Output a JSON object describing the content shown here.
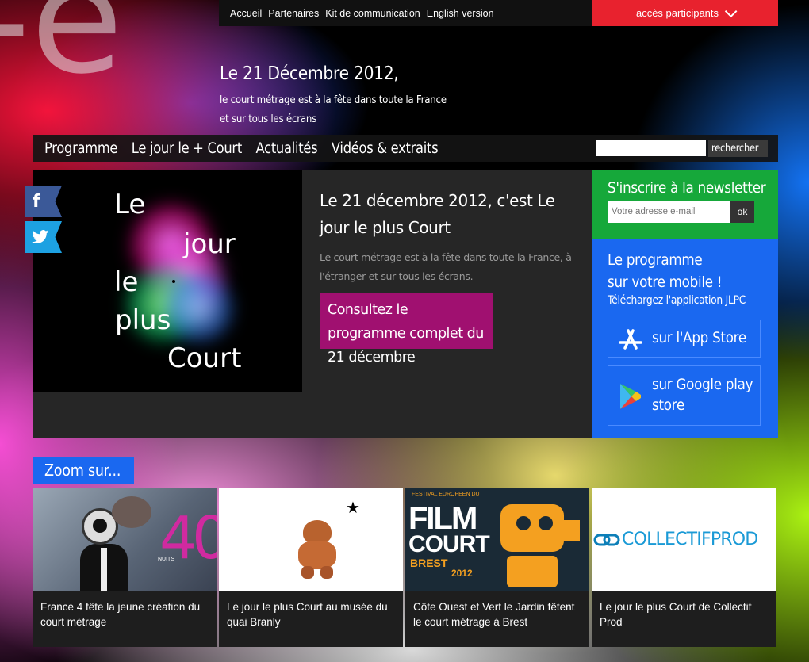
{
  "topnav": {
    "links": [
      "Accueil",
      "Partenaires",
      "Kit de communication",
      "English version"
    ],
    "acces_label": "accès participants"
  },
  "hero": {
    "title": "Le 21 Décembre 2012,",
    "subtitle_line1": "le court métrage est à la fête dans toute la France",
    "subtitle_line2": "et sur tous les écrans"
  },
  "mainnav": {
    "items": [
      "Programme",
      "Le jour le + Court",
      "Actualités",
      "Vidéos & extraits"
    ],
    "search_button": "rechercher",
    "search_placeholder": ""
  },
  "feature": {
    "image_words": [
      "Le",
      "jour",
      "le",
      "plus",
      "Court"
    ],
    "title": "Le 21 décembre 2012, c'est Le jour le plus Court",
    "text": "Le court métrage est à la fête dans toute la France, à l'étranger et sur tous les écrans.",
    "cta": "Consultez le programme complet du 21 décembre"
  },
  "social": {
    "facebook_glyph": "f",
    "twitter_glyph": "t"
  },
  "newsletter": {
    "title": "S'inscrire à la newsletter",
    "placeholder": "Votre adresse e-mail",
    "button": "ok"
  },
  "mobile": {
    "title_line1": "Le programme",
    "title_line2": "sur votre mobile !",
    "subtitle": "Téléchargez l'application JLPC",
    "appstore": "sur l'App Store",
    "googleplay_line1": "sur Google play",
    "googleplay_line2": "store"
  },
  "zoom": {
    "title": "Zoom sur...",
    "cards": [
      {
        "caption": "France 4 fête la jeune création du court métrage",
        "image_text": "NUITS",
        "image_number": "40"
      },
      {
        "caption": "Le jour le plus Court au musée du quai Branly",
        "image_text": "★"
      },
      {
        "caption": "Côte Ouest et Vert le Jardin fêtent le court métrage à Brest",
        "image_text": "FESTIVAL EUROPEEN DU",
        "image_title_1": "FILM",
        "image_title_2": "COURT",
        "image_city": "BREST",
        "image_year": "2012"
      },
      {
        "caption": "Le jour le plus Court de Collectif Prod",
        "image_text": "COLLECTIFPROD"
      }
    ]
  },
  "colors": {
    "accent_red": "#e8222e",
    "accent_green": "#16a83a",
    "accent_blue": "#1a68f0",
    "accent_magenta": "#a01070"
  }
}
